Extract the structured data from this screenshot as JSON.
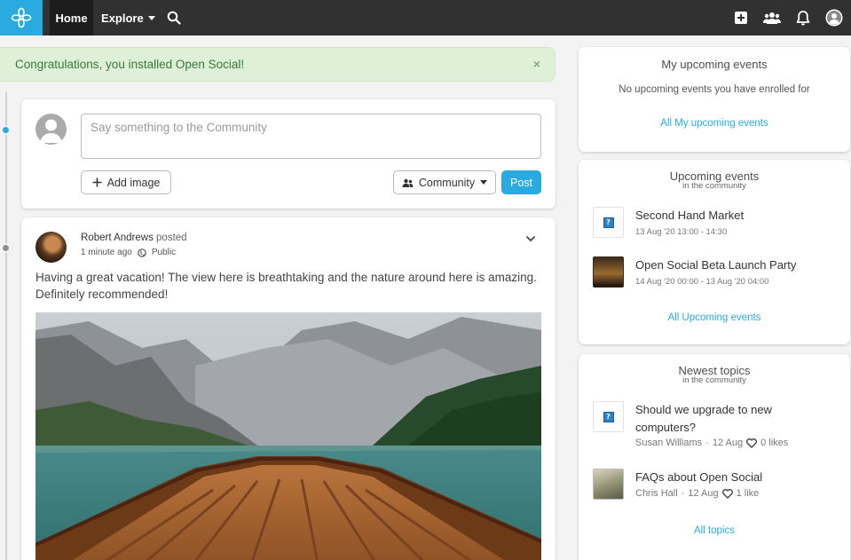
{
  "nav": {
    "home": "Home",
    "explore": "Explore"
  },
  "alert": {
    "message": "Congratulations, you installed Open Social!",
    "close": "×"
  },
  "composer": {
    "placeholder": "Say something to the Community",
    "add_image": "Add image",
    "visibility": "Community",
    "post": "Post"
  },
  "post": {
    "author": "Robert Andrews",
    "verb": "posted",
    "time": "1 minute ago",
    "visibility": "Public",
    "text": "Having a great vacation! The view here is breathtaking and the nature around here is amazing. Definitely recommended!"
  },
  "my_events": {
    "title": "My upcoming events",
    "empty": "No upcoming events you have enrolled for",
    "link": "All My upcoming events"
  },
  "upcoming": {
    "title": "Upcoming events",
    "subtitle": "in the community",
    "items": [
      {
        "title": "Second Hand Market",
        "date": "13 Aug '20 13:00 - 14:30"
      },
      {
        "title": "Open Social Beta Launch Party",
        "date": "14 Aug '20 00:00 - 13 Aug '20 04:00"
      }
    ],
    "link": "All Upcoming events"
  },
  "topics": {
    "title": "Newest topics",
    "subtitle": "in the community",
    "items": [
      {
        "title": "Should we upgrade to new computers?",
        "author": "Susan Williams",
        "date": "12 Aug",
        "likes": "0 likes"
      },
      {
        "title": "FAQs about Open Social",
        "author": "Chris Hall",
        "date": "12 Aug",
        "likes": "1 like"
      }
    ],
    "link": "All topics"
  },
  "colors": {
    "brand": "#29abe2",
    "navbar": "#313131",
    "alert_bg": "#dff0d8"
  }
}
